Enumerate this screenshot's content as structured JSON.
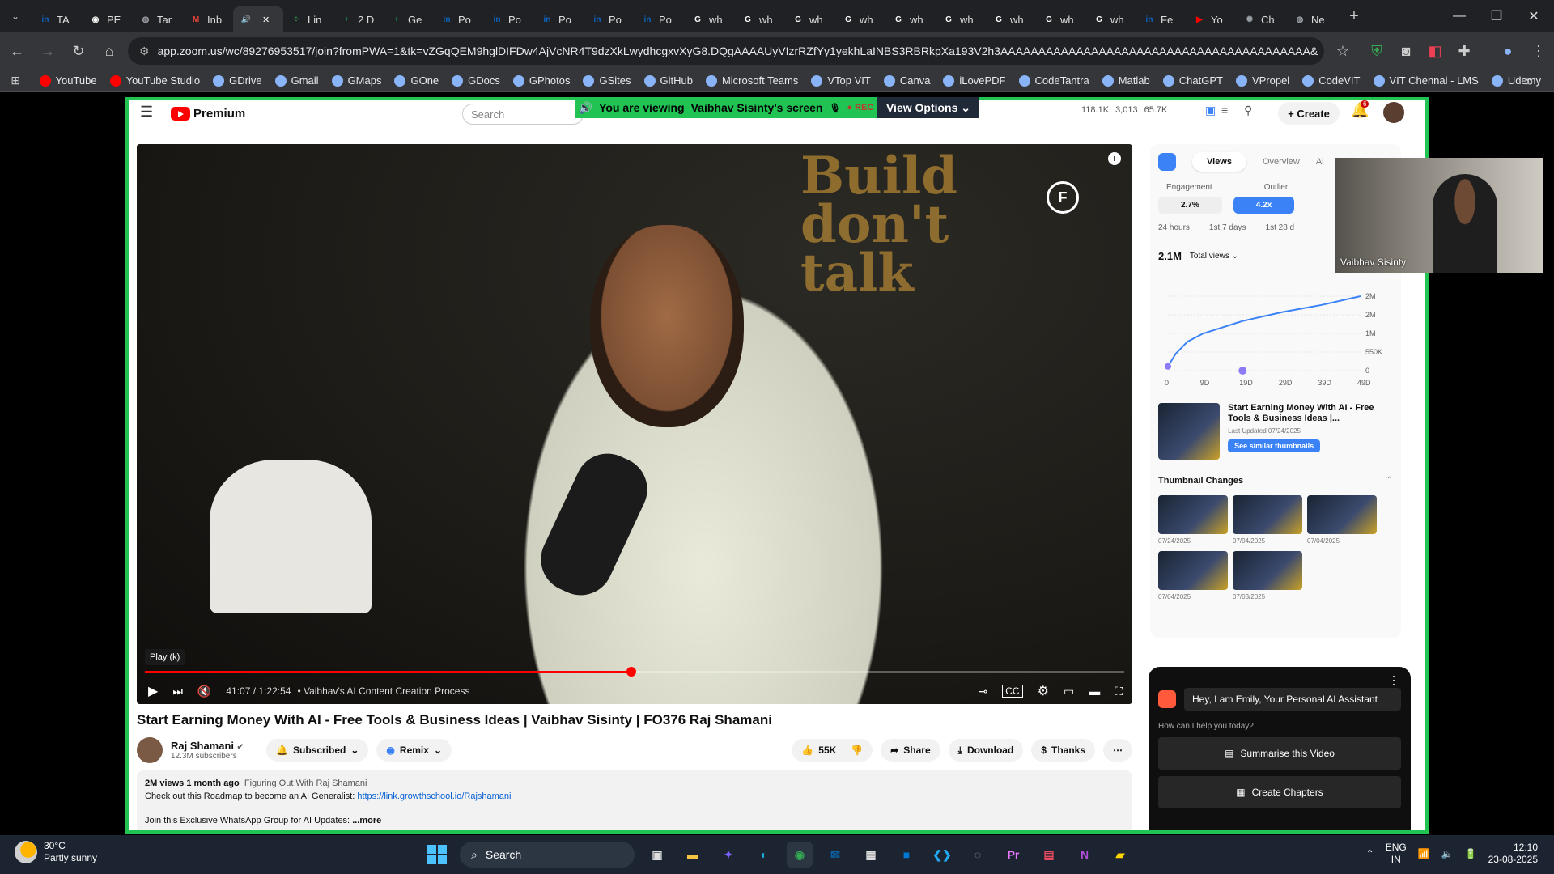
{
  "browser": {
    "tabs": [
      {
        "label": "TA",
        "icon": "linkedin-icon",
        "color": "#0a66c2",
        "glyph": "in"
      },
      {
        "label": "PE",
        "icon": "github-icon",
        "color": "#ffffff",
        "glyph": "◉"
      },
      {
        "label": "Tar",
        "icon": "globe-icon",
        "color": "#9aa0a6",
        "glyph": "◍"
      },
      {
        "label": "Inb",
        "icon": "gmail-icon",
        "color": "#ea4335",
        "glyph": "M"
      },
      {
        "label": "",
        "icon": "audio-icon",
        "color": "#9aa0a6",
        "glyph": "🔊",
        "active": true
      },
      {
        "label": "Lin",
        "icon": "linear-icon",
        "color": "#34a853",
        "glyph": "⁘"
      },
      {
        "label": "2 D",
        "icon": "sheets-icon",
        "color": "#0f9d58",
        "glyph": "+"
      },
      {
        "label": "Ge",
        "icon": "sheets-icon",
        "color": "#0f9d58",
        "glyph": "+"
      },
      {
        "label": "Po",
        "icon": "linkedin-icon",
        "color": "#0a66c2",
        "glyph": "in"
      },
      {
        "label": "Po",
        "icon": "linkedin-icon",
        "color": "#0a66c2",
        "glyph": "in"
      },
      {
        "label": "Po",
        "icon": "linkedin-icon",
        "color": "#0a66c2",
        "glyph": "in"
      },
      {
        "label": "Po",
        "icon": "linkedin-icon",
        "color": "#0a66c2",
        "glyph": "in"
      },
      {
        "label": "Po",
        "icon": "linkedin-icon",
        "color": "#0a66c2",
        "glyph": "in"
      },
      {
        "label": "wh",
        "icon": "chrome-icon",
        "color": "#ffffff",
        "glyph": "G"
      },
      {
        "label": "wh",
        "icon": "chrome-icon",
        "color": "#ffffff",
        "glyph": "G"
      },
      {
        "label": "wh",
        "icon": "chrome-icon",
        "color": "#ffffff",
        "glyph": "G"
      },
      {
        "label": "wh",
        "icon": "chrome-icon",
        "color": "#ffffff",
        "glyph": "G"
      },
      {
        "label": "wh",
        "icon": "chrome-icon",
        "color": "#ffffff",
        "glyph": "G"
      },
      {
        "label": "wh",
        "icon": "chrome-icon",
        "color": "#ffffff",
        "glyph": "G"
      },
      {
        "label": "wh",
        "icon": "chrome-icon",
        "color": "#ffffff",
        "glyph": "G"
      },
      {
        "label": "wh",
        "icon": "chrome-icon",
        "color": "#ffffff",
        "glyph": "G"
      },
      {
        "label": "wh",
        "icon": "chrome-icon",
        "color": "#ffffff",
        "glyph": "G"
      },
      {
        "label": "Fe",
        "icon": "linkedin-icon",
        "color": "#0a66c2",
        "glyph": "in"
      },
      {
        "label": "Yo",
        "icon": "youtube-icon",
        "color": "#ff0000",
        "glyph": "▶"
      },
      {
        "label": "Ch",
        "icon": "openai-icon",
        "color": "#9aa0a6",
        "glyph": "✺"
      },
      {
        "label": "Ne",
        "icon": "globe-icon",
        "color": "#9aa0a6",
        "glyph": "◍"
      }
    ],
    "url": "app.zoom.us/wc/89276953517/join?fromPWA=1&tk=vZGqQEM9hglDIFDw4AjVcNR4T9dzXkLwydhcgxvXyG8.DQgAAAAUyVIzrRZfYy1yekhLaINBS3RBRkpXa193V2h3AAAAAAAAAAAAAAAAAAAAAAAAAAAAAAAAAAAAAAAAA&_x_zm_r...",
    "bookmarks": [
      "YouTube",
      "YouTube Studio",
      "GDrive",
      "Gmail",
      "GMaps",
      "GOne",
      "GDocs",
      "GPhotos",
      "GSites",
      "GitHub",
      "Microsoft Teams",
      "VTop VIT",
      "Canva",
      "iLovePDF",
      "CodeTantra",
      "Matlab",
      "ChatGPT",
      "VPropel",
      "CodeVIT",
      "VIT Chennai - LMS",
      "Udemy"
    ]
  },
  "zoom": {
    "banner_text": "You are viewing",
    "banner_name": "Vaibhav Sisinty's screen",
    "rec": "REC",
    "view_options": "View Options",
    "participant_name": "Vaibhav Sisinty"
  },
  "youtube": {
    "logo_text": "Premium",
    "search_placeholder": "Search",
    "stats": [
      "118.1K",
      "3,013",
      "65.7K"
    ],
    "create": "Create",
    "notif_count": "6",
    "tooltip": "Play (k)",
    "time": "41:07 / 1:22:54",
    "chapter": "• Vaibhav's AI Content Creation Process",
    "progress": 0.497,
    "title": "Start Earning Money With AI - Free Tools & Business Ideas | Vaibhav Sisinty | FO376 Raj Shamani",
    "channel": "Raj Shamani",
    "subscribers": "12.3M subscribers",
    "subscribed": "Subscribed",
    "remix": "Remix",
    "likes": "55K",
    "share": "Share",
    "download": "Download",
    "thanks": "Thanks",
    "desc_meta": "2M views  1 month ago",
    "desc_tag": "Figuring Out With Raj Shamani",
    "desc_line": "Check out this Roadmap to become an AI Generalist:",
    "desc_link": "https://link.growthschool.io/Rajshamani",
    "desc_line2": "Join this Exclusive WhatsApp Group for AI Updates:",
    "desc_more": "...more"
  },
  "analytics": {
    "tabs": [
      "Views",
      "Overview",
      "Al"
    ],
    "engagement_label": "Engagement",
    "outlier_label": "Outlier",
    "engagement": "2.7%",
    "outlier": "4.2x",
    "periods": [
      "24 hours",
      "1st 7 days",
      "1st 28 d"
    ],
    "total": "2.1M",
    "total_label": "Total views",
    "card_title": "Start Earning Money With AI - Free Tools & Business Ideas |...",
    "card_date": "Last Updated 07/24/2025",
    "similar": "See similar thumbnails",
    "thumb_changes": "Thumbnail Changes",
    "thumb_dates": [
      "07/24/2025",
      "07/04/2025",
      "07/04/2025",
      "07/04/2025",
      "07/03/2025"
    ]
  },
  "chart_data": {
    "type": "line",
    "x_ticks": [
      "0",
      "9D",
      "19D",
      "29D",
      "39D",
      "49D"
    ],
    "y_ticks": [
      "2M",
      "2M",
      "1M",
      "550K",
      "0"
    ],
    "x": [
      0,
      2,
      5,
      9,
      19,
      29,
      39,
      49
    ],
    "values": [
      120000,
      480000,
      820000,
      1050000,
      1400000,
      1650000,
      1850000,
      2100000
    ],
    "ylim": [
      0,
      2100000
    ],
    "title": "",
    "xlabel": "",
    "ylabel": ""
  },
  "assistant": {
    "greeting": "Hey, I am Emily, Your Personal AI Assistant",
    "help": "How can I help you today?",
    "buttons": [
      "Summarise this Video",
      "Create Chapters"
    ]
  },
  "taskbar": {
    "temp": "30°C",
    "weather": "Partly sunny",
    "search": "Search",
    "lang1": "ENG",
    "lang2": "IN",
    "time": "12:10",
    "date": "23-08-2025"
  },
  "colors": {
    "zoom_green": "#21c353",
    "yt_red": "#ff0000",
    "accent_blue": "#3b82f6"
  }
}
